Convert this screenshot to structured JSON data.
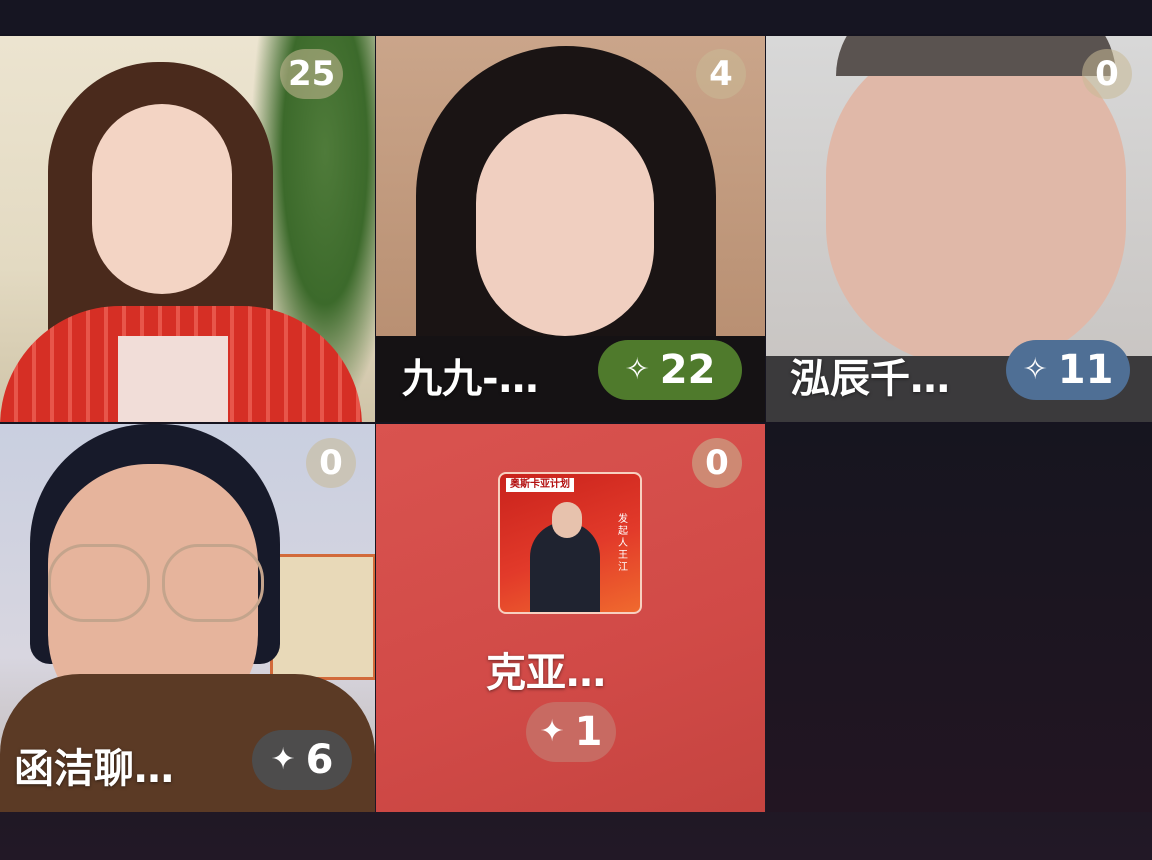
{
  "tiles": [
    {
      "id": "t1",
      "count": "25"
    },
    {
      "id": "t2",
      "count": "4",
      "name": "九九-…",
      "likes": "22",
      "like_color": "#4f7a2c"
    },
    {
      "id": "t3",
      "count": "0",
      "name": "泓辰千…",
      "likes": "11",
      "like_color": "#4f6f95"
    },
    {
      "id": "t4",
      "count": "0",
      "name": "函洁聊…",
      "likes": "6",
      "like_color": "#4d4c4c"
    },
    {
      "id": "t5",
      "count": "0",
      "name": "克亚…",
      "likes": "1",
      "like_color": "#c86a62",
      "poster_title": "奥斯卡亚计划",
      "poster_sub": "发起人 王江"
    }
  ],
  "icons": {
    "like": "sparkle-icon"
  },
  "colors": {
    "bg": "#14131f",
    "tile5_bg": "#d9534f"
  }
}
